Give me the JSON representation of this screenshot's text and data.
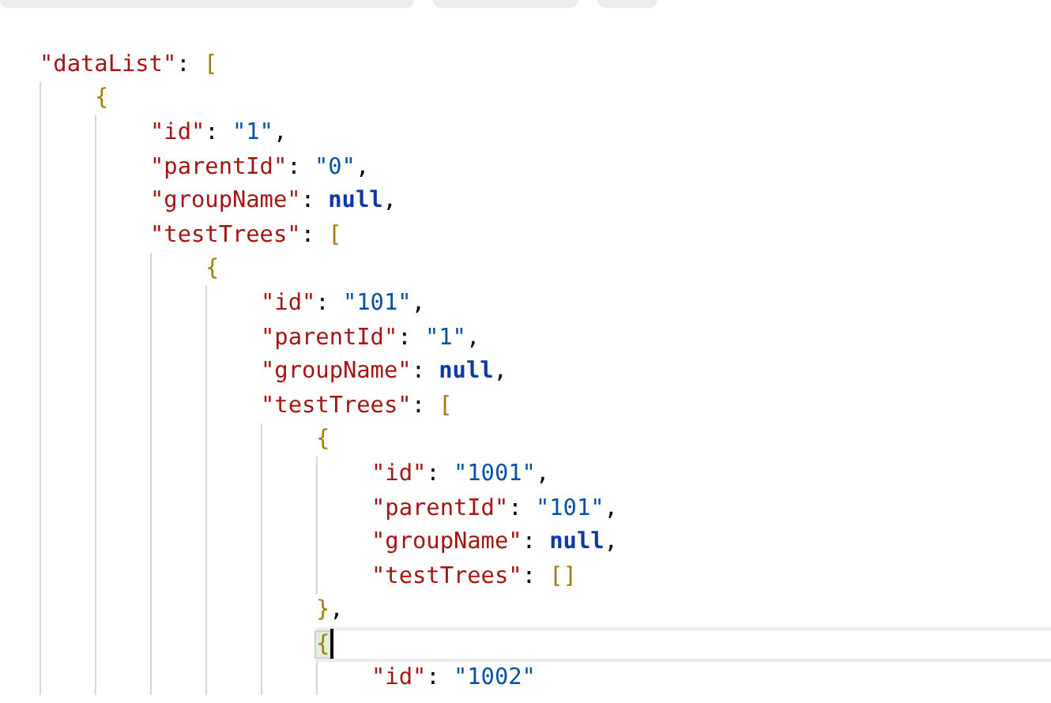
{
  "top_tabs": [
    {
      "kind": "wide"
    },
    {
      "kind": "medium"
    },
    {
      "kind": "small"
    }
  ],
  "lines": [
    {
      "current": false,
      "tokens": [
        {
          "kind": "key",
          "text": "\"dataList\""
        },
        {
          "kind": "punct",
          "text": ": "
        },
        {
          "kind": "bracket",
          "text": "["
        }
      ],
      "children": [
        {
          "current": false,
          "tokens": [
            {
              "kind": "brace",
              "text": "{"
            }
          ],
          "children": [
            {
              "current": false,
              "tokens": [
                {
                  "kind": "key",
                  "text": "\"id\""
                },
                {
                  "kind": "punct",
                  "text": ": "
                },
                {
                  "kind": "string",
                  "text": "\"1\""
                },
                {
                  "kind": "punct",
                  "text": ","
                }
              ]
            },
            {
              "current": false,
              "tokens": [
                {
                  "kind": "key",
                  "text": "\"parentId\""
                },
                {
                  "kind": "punct",
                  "text": ": "
                },
                {
                  "kind": "string",
                  "text": "\"0\""
                },
                {
                  "kind": "punct",
                  "text": ","
                }
              ]
            },
            {
              "current": false,
              "tokens": [
                {
                  "kind": "key",
                  "text": "\"groupName\""
                },
                {
                  "kind": "punct",
                  "text": ": "
                },
                {
                  "kind": "null",
                  "text": "null"
                },
                {
                  "kind": "punct",
                  "text": ","
                }
              ]
            },
            {
              "current": false,
              "tokens": [
                {
                  "kind": "key",
                  "text": "\"testTrees\""
                },
                {
                  "kind": "punct",
                  "text": ": "
                },
                {
                  "kind": "bracket",
                  "text": "["
                }
              ],
              "children": [
                {
                  "current": false,
                  "tokens": [
                    {
                      "kind": "brace",
                      "text": "{"
                    }
                  ],
                  "children": [
                    {
                      "current": false,
                      "tokens": [
                        {
                          "kind": "key",
                          "text": "\"id\""
                        },
                        {
                          "kind": "punct",
                          "text": ": "
                        },
                        {
                          "kind": "string",
                          "text": "\"101\""
                        },
                        {
                          "kind": "punct",
                          "text": ","
                        }
                      ]
                    },
                    {
                      "current": false,
                      "tokens": [
                        {
                          "kind": "key",
                          "text": "\"parentId\""
                        },
                        {
                          "kind": "punct",
                          "text": ": "
                        },
                        {
                          "kind": "string",
                          "text": "\"1\""
                        },
                        {
                          "kind": "punct",
                          "text": ","
                        }
                      ]
                    },
                    {
                      "current": false,
                      "tokens": [
                        {
                          "kind": "key",
                          "text": "\"groupName\""
                        },
                        {
                          "kind": "punct",
                          "text": ": "
                        },
                        {
                          "kind": "null",
                          "text": "null"
                        },
                        {
                          "kind": "punct",
                          "text": ","
                        }
                      ]
                    },
                    {
                      "current": false,
                      "tokens": [
                        {
                          "kind": "key",
                          "text": "\"testTrees\""
                        },
                        {
                          "kind": "punct",
                          "text": ": "
                        },
                        {
                          "kind": "bracket",
                          "text": "["
                        }
                      ],
                      "children": [
                        {
                          "current": false,
                          "tokens": [
                            {
                              "kind": "brace",
                              "text": "{"
                            }
                          ],
                          "children": [
                            {
                              "current": false,
                              "tokens": [
                                {
                                  "kind": "key",
                                  "text": "\"id\""
                                },
                                {
                                  "kind": "punct",
                                  "text": ": "
                                },
                                {
                                  "kind": "string",
                                  "text": "\"1001\""
                                },
                                {
                                  "kind": "punct",
                                  "text": ","
                                }
                              ]
                            },
                            {
                              "current": false,
                              "tokens": [
                                {
                                  "kind": "key",
                                  "text": "\"parentId\""
                                },
                                {
                                  "kind": "punct",
                                  "text": ": "
                                },
                                {
                                  "kind": "string",
                                  "text": "\"101\""
                                },
                                {
                                  "kind": "punct",
                                  "text": ","
                                }
                              ]
                            },
                            {
                              "current": false,
                              "tokens": [
                                {
                                  "kind": "key",
                                  "text": "\"groupName\""
                                },
                                {
                                  "kind": "punct",
                                  "text": ": "
                                },
                                {
                                  "kind": "null",
                                  "text": "null"
                                },
                                {
                                  "kind": "punct",
                                  "text": ","
                                }
                              ]
                            },
                            {
                              "current": false,
                              "tokens": [
                                {
                                  "kind": "key",
                                  "text": "\"testTrees\""
                                },
                                {
                                  "kind": "punct",
                                  "text": ": "
                                },
                                {
                                  "kind": "bracket",
                                  "text": "[]"
                                }
                              ]
                            }
                          ]
                        },
                        {
                          "current": false,
                          "tokens": [
                            {
                              "kind": "brace",
                              "text": "}"
                            },
                            {
                              "kind": "punct",
                              "text": ","
                            }
                          ]
                        },
                        {
                          "current": true,
                          "tokens": [
                            {
                              "kind": "brace",
                              "text": "{"
                            }
                          ],
                          "children": [
                            {
                              "current": false,
                              "tokens": [
                                {
                                  "kind": "key",
                                  "text": "\"id\""
                                },
                                {
                                  "kind": "punct",
                                  "text": ": "
                                },
                                {
                                  "kind": "string",
                                  "text": "\"1002\""
                                }
                              ]
                            }
                          ]
                        }
                      ]
                    }
                  ]
                }
              ]
            }
          ]
        }
      ]
    }
  ]
}
